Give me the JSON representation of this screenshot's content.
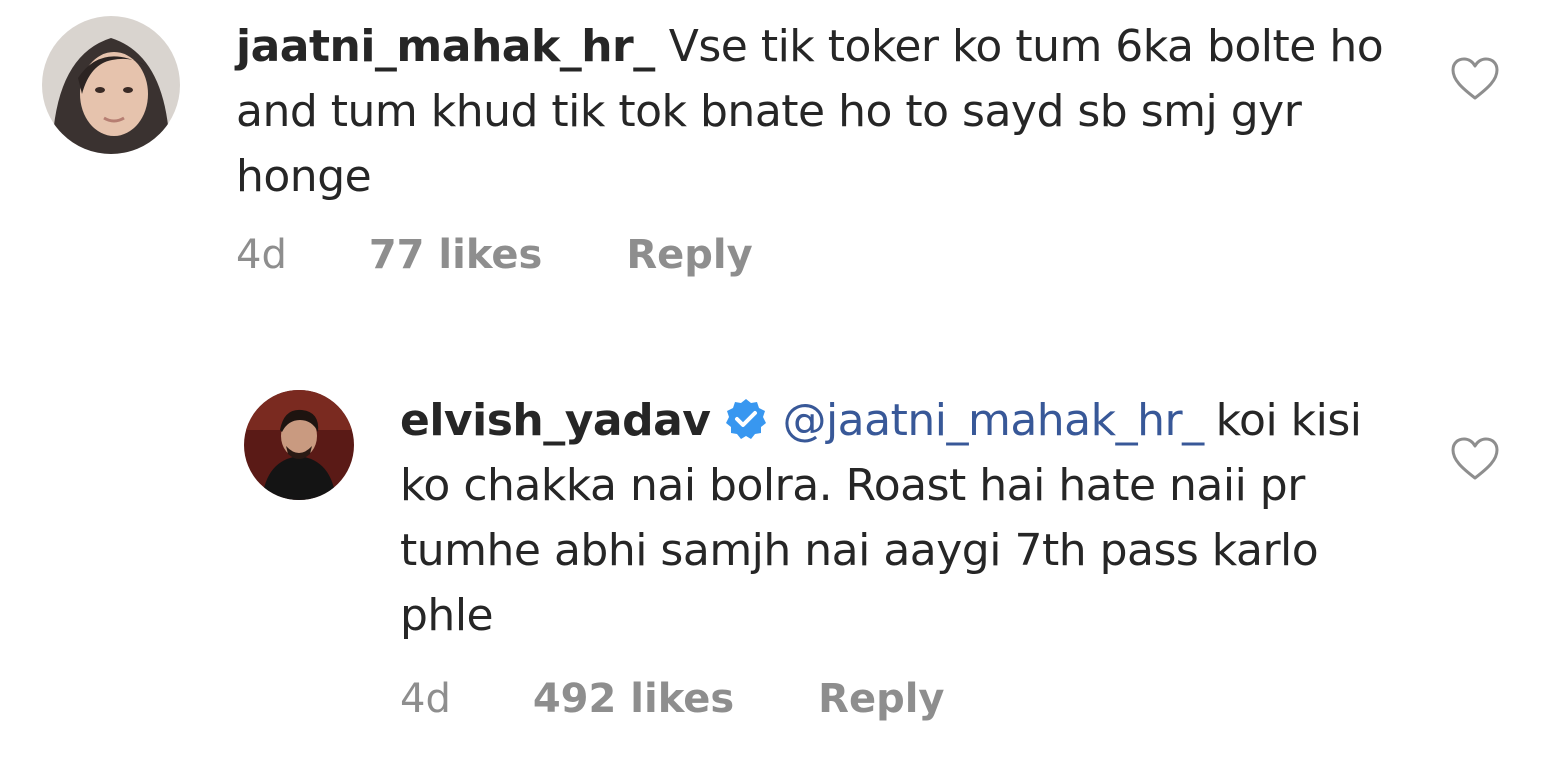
{
  "comments": [
    {
      "username": "jaatni_mahak_hr_",
      "text": "Vse tik toker ko tum 6ka bolte ho and tum khud tik tok bnate ho to sayd sb smj gyr honge",
      "time": "4d",
      "likes": "77 likes",
      "reply_label": "Reply",
      "icons": {
        "avatar": "profile-photo-avatar",
        "like": "heart-outline-icon"
      }
    },
    {
      "username": "elvish_yadav",
      "mention": "@jaatni_mahak_hr_",
      "text": "koi kisi ko chakka nai bolra. Roast hai hate naii pr tumhe abhi samjh nai aaygi 7th pass karlo phle",
      "time": "4d",
      "likes": "492 likes",
      "reply_label": "Reply",
      "icons": {
        "avatar": "profile-photo-avatar",
        "verified": "verified-badge-icon",
        "like": "heart-outline-icon"
      }
    }
  ],
  "colors": {
    "text": "#262626",
    "secondary": "#8e8e8e",
    "mention": "#385898",
    "verified": "#3897f0"
  }
}
